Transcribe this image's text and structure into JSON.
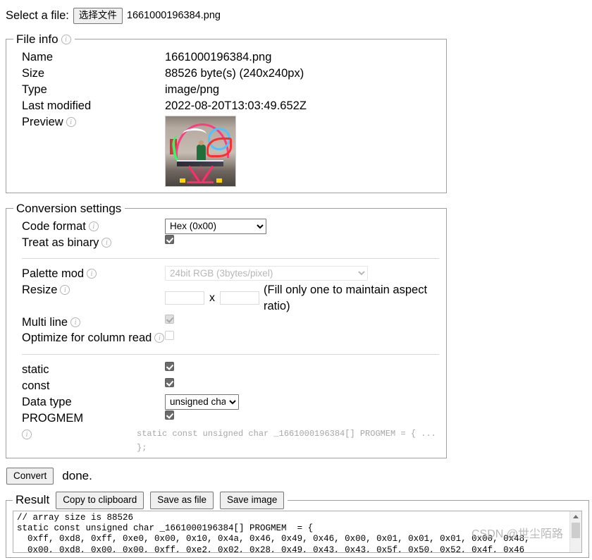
{
  "file_select": {
    "label": "Select a file:",
    "button_label": "选择文件",
    "file_name": "1661000196384.png"
  },
  "file_info": {
    "legend": "File info",
    "rows": [
      {
        "key": "Name",
        "value": "1661000196384.png"
      },
      {
        "key": "Size",
        "value": "88526 byte(s) (240x240px)"
      },
      {
        "key": "Type",
        "value": "image/png"
      },
      {
        "key": "Last modified",
        "value": "2022-08-20T13:03:49.652Z"
      }
    ],
    "preview_label": "Preview"
  },
  "conversion": {
    "legend": "Conversion settings",
    "code_format_label": "Code format",
    "code_format_value": "Hex (0x00)",
    "code_format_options": [
      "Hex (0x00)"
    ],
    "treat_as_binary_label": "Treat as binary",
    "treat_as_binary_checked": true,
    "palette_mod_label": "Palette mod",
    "palette_mod_value": "24bit RGB (3bytes/pixel)",
    "palette_mod_options": [
      "24bit RGB (3bytes/pixel)"
    ],
    "resize_label": "Resize",
    "resize_width": "",
    "resize_height": "",
    "resize_separator": "x",
    "resize_hint": "(Fill only one to maintain aspect ratio)",
    "multi_line_label": "Multi line",
    "multi_line_checked": true,
    "optimize_label": "Optimize for column read",
    "optimize_checked": false,
    "static_label": "static",
    "static_checked": true,
    "const_label": "const",
    "const_checked": true,
    "data_type_label": "Data type",
    "data_type_value": "unsigned char",
    "data_type_options": [
      "unsigned char"
    ],
    "progmem_label": "PROGMEM",
    "progmem_checked": true,
    "signature_preview": "static const unsigned char _1661000196384[] PROGMEM = { ... };"
  },
  "convert": {
    "button_label": "Convert",
    "status": "done."
  },
  "result": {
    "legend": "Result",
    "copy_button": "Copy to clipboard",
    "save_file_button": "Save as file",
    "save_image_button": "Save image",
    "text": "// array size is 88526\nstatic const unsigned char _1661000196384[] PROGMEM  = {\n  0xff, 0xd8, 0xff, 0xe0, 0x00, 0x10, 0x4a, 0x46, 0x49, 0x46, 0x00, 0x01, 0x01, 0x01, 0x00, 0x48,\n  0x00, 0xd8, 0x00, 0x00, 0xff, 0xe2, 0x02, 0x28, 0x49, 0x43, 0x43, 0x5f, 0x50, 0x52, 0x4f, 0x46"
  },
  "watermark": "CSDN @世尘陌路",
  "colors": {
    "border": "#a0a0a0",
    "checkbox": "#6b6b6b",
    "disabled_text": "#9a9a9a",
    "watermark": "#b9b9b9"
  }
}
